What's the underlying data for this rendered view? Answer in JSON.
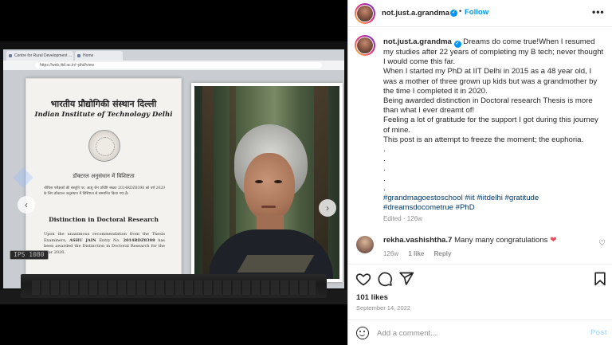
{
  "post": {
    "username": "not.just.a.grandma",
    "follow_label": "Follow",
    "more_icon": "more-horizontal-icon",
    "caption_lines": [
      "Dreams do come true!When I resumed my studies after 22 years of completing my B tech; never thought I would come this far.",
      "When I started my PhD at IIT Delhi in 2015 as a 48 year old, I was a mother of three grown up kids but was a grandmother by the time I completed it in 2020.",
      "Being awarded distinction in Doctoral research Thesis is more than what I ever dreamt of!",
      "Feeling a lot of gratitude for the support I got during this journey of mine.",
      "This post is an attempt to freeze the moment; the euphoria.",
      ".",
      ".",
      ".",
      ".",
      "."
    ],
    "hashtags_line1": "#grandmagoestoschool #iit #iitdelhi #gratitude",
    "hashtags_line2": "#dreamsdocometrue #PhD",
    "edited_label": "Edited · 126w"
  },
  "comment": {
    "username": "rekha.vashishtha.7",
    "text": "Many many congratulations",
    "emoji": "❤",
    "age": "126w",
    "likes": "1 like",
    "reply_label": "Reply"
  },
  "actions": {
    "likes_count": "101 likes",
    "date": "September 14, 2022"
  },
  "add_comment": {
    "placeholder": "Add a comment...",
    "post_label": "Post"
  },
  "photo": {
    "browser_tab_1": "Centre for Rural Development ...",
    "browser_tab_2": "Home",
    "address": "https://web.iitd.ac.in/~phd/view",
    "cert_hindi": "भारतीय प्रौद्योगिकी संस्थान दिल्ली",
    "cert_english": "Indian Institute of Technology Delhi",
    "cert_subtitle": "डॉक्टरल अनुसंधान में विशिष्टता",
    "cert_hindi_body": "चौथिस परीक्षकों की संस्तुति पर, आशु जैन प्रविष्टि संख्या 2014RDZ8398 को वर्ष 2020 के लिए डॉक्टरल अनुसंधान में विशिष्टता से सम्मानित किया गया है।",
    "cert_title": "Distinction in Doctoral Research",
    "cert_body_lead": "Upon the unanimous recommendation from the Thesis Examiners,",
    "cert_body_name": "ASHU JAIN",
    "cert_body_entry": "Entry No.",
    "cert_body_entry_no": "2014RDZ8398",
    "cert_body_tail": "has been awarded the Distinction in Doctoral Research for the year 2020.",
    "bezel_label": "IPS 1080",
    "prev_icon": "chevron-left-icon",
    "next_icon": "chevron-right-icon"
  },
  "colors": {
    "accent": "#0095f6",
    "like_red": "#ed4956",
    "hashtag": "#00376b",
    "muted": "#8e8e8e"
  }
}
